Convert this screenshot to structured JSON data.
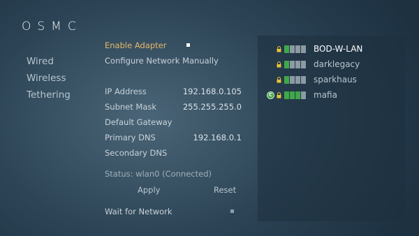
{
  "app": {
    "logo": "OSMC"
  },
  "sidebar": {
    "items": [
      {
        "label": "Wired"
      },
      {
        "label": "Wireless"
      },
      {
        "label": "Tethering"
      }
    ]
  },
  "settings": {
    "enable_adapter": {
      "label": "Enable Adapter",
      "checked": true
    },
    "configure_manually": {
      "label": "Configure Network Manually"
    },
    "ip_address": {
      "label": "IP Address",
      "value": "192.168.0.105"
    },
    "subnet_mask": {
      "label": "Subnet Mask",
      "value": "255.255.255.0"
    },
    "default_gateway": {
      "label": "Default Gateway",
      "value": ""
    },
    "primary_dns": {
      "label": "Primary DNS",
      "value": "192.168.0.1"
    },
    "secondary_dns": {
      "label": "Secondary DNS",
      "value": ""
    },
    "status": "Status: wlan0 (Connected)",
    "apply_label": "Apply",
    "reset_label": "Reset",
    "wait_for_network": {
      "label": "Wait for Network",
      "checked": false
    }
  },
  "networks": [
    {
      "name": "BOD-W-LAN",
      "strength_bars": 1,
      "secured": true,
      "connected": false,
      "selected": true
    },
    {
      "name": "darklegacy",
      "strength_bars": 1,
      "secured": true,
      "connected": false,
      "selected": false
    },
    {
      "name": "sparkhaus",
      "strength_bars": 1,
      "secured": true,
      "connected": false,
      "selected": false
    },
    {
      "name": "mafia",
      "strength_bars": 3,
      "secured": true,
      "connected": true,
      "selected": false
    }
  ],
  "colors": {
    "accent": "#e6b86a",
    "signal": "#3fa84a",
    "signal_off": "#8c9aa3"
  },
  "icons": {
    "lock": "lock-icon",
    "signal": "signal-strength-icon",
    "connected": "connected-icon"
  }
}
